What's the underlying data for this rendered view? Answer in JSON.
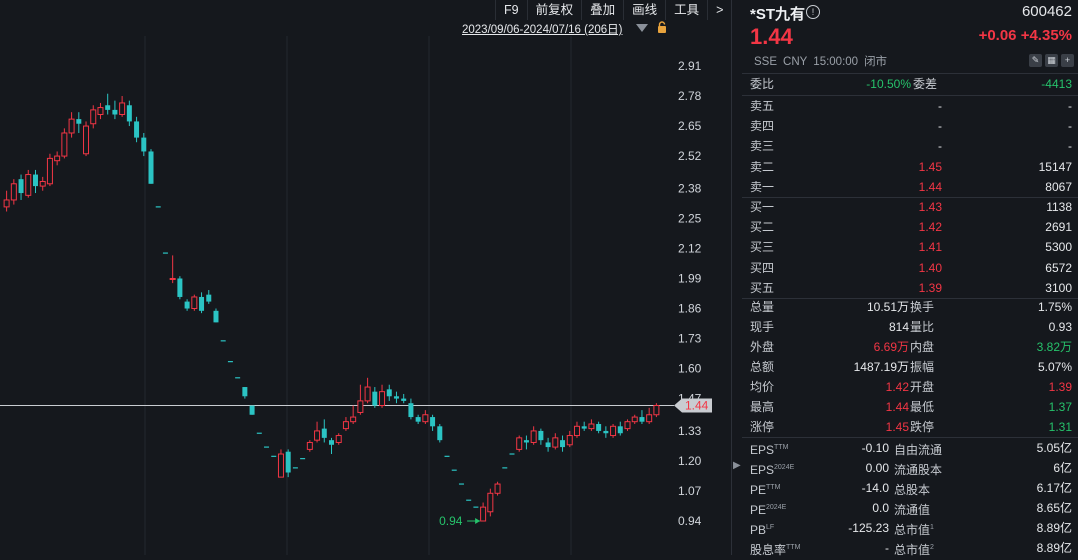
{
  "toolbar": {
    "items": [
      "F9",
      "前复权",
      "叠加",
      "画线",
      "工具",
      ">"
    ]
  },
  "chart_header": {
    "date_range": "2023/09/06-2024/07/16 (206日)"
  },
  "chart_data": {
    "type": "candlestick",
    "y_ticks": [
      "2.91",
      "2.78",
      "2.65",
      "2.52",
      "2.38",
      "2.25",
      "2.12",
      "1.99",
      "1.86",
      "1.73",
      "1.60",
      "1.47",
      "1.33",
      "1.20",
      "1.07",
      "0.94"
    ],
    "y_range": [
      0.94,
      2.91
    ],
    "current_price_label": "1.44",
    "current_price": 1.44,
    "low_annotation": "0.94",
    "low_value": 0.94,
    "colors": {
      "up": "#f23645",
      "down": "#2bc4c4",
      "limit_dash": "#2bc4c4"
    },
    "candles": [
      [
        2.3,
        2.33,
        2.37,
        2.28
      ],
      [
        2.33,
        2.4,
        2.42,
        2.31
      ],
      [
        2.42,
        2.36,
        2.44,
        2.33
      ],
      [
        2.35,
        2.44,
        2.46,
        2.34
      ],
      [
        2.44,
        2.39,
        2.46,
        2.36
      ],
      [
        2.39,
        2.41,
        2.43,
        2.37
      ],
      [
        2.4,
        2.51,
        2.53,
        2.39
      ],
      [
        2.5,
        2.52,
        2.54,
        2.48
      ],
      [
        2.52,
        2.62,
        2.64,
        2.51
      ],
      [
        2.62,
        2.68,
        2.71,
        2.6
      ],
      [
        2.68,
        2.66,
        2.71,
        2.62
      ],
      [
        2.53,
        2.65,
        2.67,
        2.52
      ],
      [
        2.66,
        2.72,
        2.74,
        2.64
      ],
      [
        2.7,
        2.73,
        2.75,
        2.68
      ],
      [
        2.74,
        2.72,
        2.79,
        2.7
      ],
      [
        2.72,
        2.7,
        2.76,
        2.68
      ],
      [
        2.7,
        2.75,
        2.78,
        2.69
      ],
      [
        2.74,
        2.67,
        2.76,
        2.65
      ],
      [
        2.67,
        2.6,
        2.69,
        2.58
      ],
      [
        2.6,
        2.54,
        2.62,
        2.52
      ],
      [
        2.54,
        2.4,
        2.55,
        2.4
      ],
      [
        2.3,
        2.3,
        2.3,
        2.3
      ],
      [
        2.1,
        2.1,
        2.1,
        2.1
      ],
      [
        1.99,
        1.99,
        2.09,
        1.97
      ],
      [
        1.99,
        1.91,
        2.0,
        1.9
      ],
      [
        1.89,
        1.86,
        1.9,
        1.85
      ],
      [
        1.86,
        1.91,
        1.92,
        1.85
      ],
      [
        1.91,
        1.85,
        1.93,
        1.84
      ],
      [
        1.92,
        1.89,
        1.94,
        1.88
      ],
      [
        1.85,
        1.8,
        1.86,
        1.8
      ],
      [
        1.72,
        1.72,
        1.72,
        1.72
      ],
      [
        1.63,
        1.63,
        1.63,
        1.63
      ],
      [
        1.56,
        1.56,
        1.56,
        1.56
      ],
      [
        1.52,
        1.48,
        1.52,
        1.47
      ],
      [
        1.44,
        1.4,
        1.44,
        1.4
      ],
      [
        1.32,
        1.32,
        1.32,
        1.32
      ],
      [
        1.26,
        1.26,
        1.26,
        1.26
      ],
      [
        1.22,
        1.22,
        1.22,
        1.22
      ],
      [
        1.13,
        1.23,
        1.25,
        1.13
      ],
      [
        1.24,
        1.15,
        1.25,
        1.13
      ],
      [
        1.17,
        1.17,
        1.17,
        1.17
      ],
      [
        1.21,
        1.21,
        1.21,
        1.21
      ],
      [
        1.25,
        1.28,
        1.29,
        1.24
      ],
      [
        1.29,
        1.33,
        1.37,
        1.28
      ],
      [
        1.34,
        1.3,
        1.38,
        1.28
      ],
      [
        1.29,
        1.27,
        1.3,
        1.23
      ],
      [
        1.28,
        1.31,
        1.32,
        1.27
      ],
      [
        1.34,
        1.37,
        1.39,
        1.33
      ],
      [
        1.37,
        1.39,
        1.44,
        1.36
      ],
      [
        1.41,
        1.46,
        1.53,
        1.4
      ],
      [
        1.46,
        1.52,
        1.56,
        1.45
      ],
      [
        1.5,
        1.44,
        1.52,
        1.43
      ],
      [
        1.44,
        1.5,
        1.53,
        1.43
      ],
      [
        1.51,
        1.48,
        1.53,
        1.46
      ],
      [
        1.48,
        1.47,
        1.5,
        1.45
      ],
      [
        1.47,
        1.46,
        1.49,
        1.45
      ],
      [
        1.45,
        1.39,
        1.47,
        1.38
      ],
      [
        1.39,
        1.37,
        1.4,
        1.36
      ],
      [
        1.37,
        1.4,
        1.42,
        1.36
      ],
      [
        1.39,
        1.35,
        1.4,
        1.33
      ],
      [
        1.35,
        1.29,
        1.36,
        1.28
      ],
      [
        1.22,
        1.22,
        1.22,
        1.22
      ],
      [
        1.16,
        1.16,
        1.16,
        1.16
      ],
      [
        1.1,
        1.1,
        1.1,
        1.1
      ],
      [
        1.03,
        1.03,
        1.03,
        1.03
      ],
      [
        1.0,
        1.0,
        1.0,
        1.0
      ],
      [
        0.94,
        1.0,
        1.02,
        0.94
      ],
      [
        0.98,
        1.06,
        1.08,
        0.96
      ],
      [
        1.06,
        1.1,
        1.11,
        1.05
      ],
      [
        1.17,
        1.17,
        1.17,
        1.17
      ],
      [
        1.23,
        1.23,
        1.23,
        1.23
      ],
      [
        1.25,
        1.3,
        1.31,
        1.24
      ],
      [
        1.29,
        1.28,
        1.31,
        1.25
      ],
      [
        1.28,
        1.33,
        1.35,
        1.27
      ],
      [
        1.33,
        1.29,
        1.34,
        1.27
      ],
      [
        1.28,
        1.26,
        1.3,
        1.24
      ],
      [
        1.26,
        1.3,
        1.32,
        1.25
      ],
      [
        1.29,
        1.26,
        1.31,
        1.24
      ],
      [
        1.27,
        1.31,
        1.33,
        1.26
      ],
      [
        1.31,
        1.35,
        1.37,
        1.3
      ],
      [
        1.35,
        1.34,
        1.37,
        1.33
      ],
      [
        1.34,
        1.36,
        1.38,
        1.33
      ],
      [
        1.36,
        1.33,
        1.37,
        1.32
      ],
      [
        1.33,
        1.32,
        1.35,
        1.3
      ],
      [
        1.31,
        1.35,
        1.36,
        1.3
      ],
      [
        1.35,
        1.32,
        1.37,
        1.31
      ],
      [
        1.34,
        1.37,
        1.38,
        1.33
      ],
      [
        1.37,
        1.39,
        1.4,
        1.36
      ],
      [
        1.39,
        1.37,
        1.42,
        1.36
      ],
      [
        1.37,
        1.4,
        1.43,
        1.36
      ],
      [
        1.4,
        1.44,
        1.45,
        1.39
      ]
    ]
  },
  "quote": {
    "name": "*ST九有",
    "code": "600462",
    "price": "1.44",
    "change": "+0.06",
    "change_pct": "+4.35%",
    "exchange": "SSE",
    "currency": "CNY",
    "time": "15:00:00",
    "status": "闭市"
  },
  "weibi": {
    "label": "委比",
    "value": "-10.50%",
    "label2": "委差",
    "value2": "-4413"
  },
  "asks": [
    {
      "label": "卖五",
      "price": "-",
      "vol": "-"
    },
    {
      "label": "卖四",
      "price": "-",
      "vol": "-"
    },
    {
      "label": "卖三",
      "price": "-",
      "vol": "-"
    },
    {
      "label": "卖二",
      "price": "1.45",
      "vol": "15147"
    },
    {
      "label": "卖一",
      "price": "1.44",
      "vol": "8067"
    }
  ],
  "bids": [
    {
      "label": "买一",
      "price": "1.43",
      "vol": "1138"
    },
    {
      "label": "买二",
      "price": "1.42",
      "vol": "2691"
    },
    {
      "label": "买三",
      "price": "1.41",
      "vol": "5300"
    },
    {
      "label": "买四",
      "price": "1.40",
      "vol": "6572"
    },
    {
      "label": "买五",
      "price": "1.39",
      "vol": "3100"
    }
  ],
  "stats": [
    {
      "l1": "总量",
      "v1": "10.51万",
      "c1": "white",
      "l2": "换手",
      "v2": "1.75%",
      "c2": "white"
    },
    {
      "l1": "现手",
      "v1": "814",
      "c1": "white",
      "l2": "量比",
      "v2": "0.93",
      "c2": "white"
    },
    {
      "l1": "外盘",
      "v1": "6.69万",
      "c1": "red",
      "l2": "内盘",
      "v2": "3.82万",
      "c2": "green"
    },
    {
      "l1": "总额",
      "v1": "1487.19万",
      "c1": "white",
      "l2": "振幅",
      "v2": "5.07%",
      "c2": "white"
    },
    {
      "l1": "均价",
      "v1": "1.42",
      "c1": "red",
      "l2": "开盘",
      "v2": "1.39",
      "c2": "red"
    },
    {
      "l1": "最高",
      "v1": "1.44",
      "c1": "red",
      "l2": "最低",
      "v2": "1.37",
      "c2": "green"
    },
    {
      "l1": "涨停",
      "v1": "1.45",
      "c1": "red",
      "l2": "跌停",
      "v2": "1.31",
      "c2": "green"
    }
  ],
  "fundamentals": [
    {
      "l1": "EPS",
      "s1": "TTM",
      "v1": "-0.10",
      "l2": "自由流通",
      "s2": "",
      "v2": "5.05亿"
    },
    {
      "l1": "EPS",
      "s1": "2024E",
      "v1": "0.00",
      "l2": "流通股本",
      "s2": "",
      "v2": "6亿"
    },
    {
      "l1": "PE",
      "s1": "TTM",
      "v1": "-14.0",
      "l2": "总股本",
      "s2": "",
      "v2": "6.17亿"
    },
    {
      "l1": "PE",
      "s1": "2024E",
      "v1": "0.0",
      "l2": "流通值",
      "s2": "",
      "v2": "8.65亿"
    },
    {
      "l1": "PB",
      "s1": "LF",
      "v1": "-125.23",
      "l2": "总市值",
      "s2": "1",
      "v2": "8.89亿"
    },
    {
      "l1": "股息率",
      "s1": "TTM",
      "v1": "-",
      "l2": "总市值",
      "s2": "2",
      "v2": "8.89亿"
    }
  ]
}
